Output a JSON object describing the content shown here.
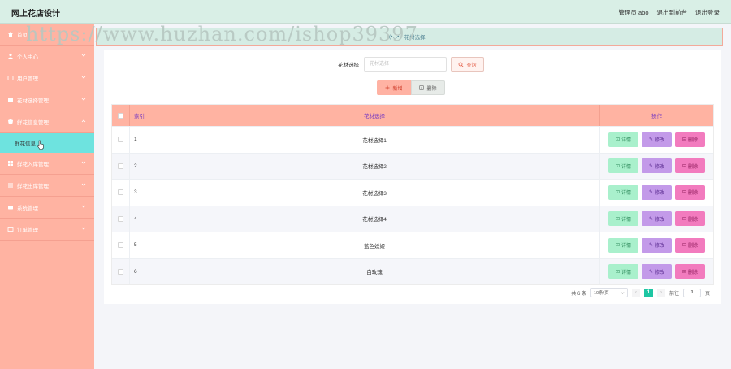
{
  "header": {
    "title": "网上花店设计",
    "admin_label": "管理员 abo",
    "back_label": "退出到前台",
    "logout_label": "退出登录"
  },
  "watermark": "https://www.huzhan.com/ishop39397",
  "sidebar": {
    "items": [
      {
        "label": "首页",
        "icon": "home-icon"
      },
      {
        "label": "个人中心",
        "icon": "user-icon"
      },
      {
        "label": "用户管理",
        "icon": "users-icon"
      },
      {
        "label": "花材选择管理",
        "icon": "flower-icon"
      },
      {
        "label": "鲜花信息管理",
        "icon": "shield-icon"
      },
      {
        "label": "鲜花入库管理",
        "icon": "inbox-icon"
      },
      {
        "label": "鲜花出库管理",
        "icon": "outbox-icon"
      },
      {
        "label": "系统管理",
        "icon": "settings-icon"
      },
      {
        "label": "订单管理",
        "icon": "order-icon"
      }
    ],
    "active_sub": "鲜花信息"
  },
  "breadcrumb": {
    "sep": "(•◡•)",
    "current": "花材选择"
  },
  "search": {
    "label": "花材选择",
    "placeholder": "花材选择",
    "button": "查询"
  },
  "actions": {
    "add": "新增",
    "delete": "删除"
  },
  "table": {
    "headers": {
      "index": "索引",
      "name": "花材选择",
      "ops": "操作"
    },
    "rows": [
      {
        "index": "1",
        "name": "花材选择1"
      },
      {
        "index": "2",
        "name": "花材选择2"
      },
      {
        "index": "3",
        "name": "花材选择3"
      },
      {
        "index": "4",
        "name": "花材选择4"
      },
      {
        "index": "5",
        "name": "蓝色妖姬"
      },
      {
        "index": "6",
        "name": "白玫瑰"
      }
    ],
    "ops": {
      "detail": "详情",
      "edit": "修改",
      "delete": "删除"
    }
  },
  "pagination": {
    "total": "共 6 条",
    "page_size": "10条/页",
    "current_page": "1",
    "goto_prefix": "前往",
    "goto_value": "1",
    "goto_suffix": "页"
  },
  "colors": {
    "topbar": "#d9efe6",
    "sidebar": "#ffb3a2",
    "active_sub": "#6ee3df",
    "table_header": "#ffb3a2",
    "detail_btn": "#a9f0cc",
    "edit_btn": "#c39ae9",
    "delete_btn": "#f27bbe",
    "pager_active": "#1ec6a3"
  }
}
